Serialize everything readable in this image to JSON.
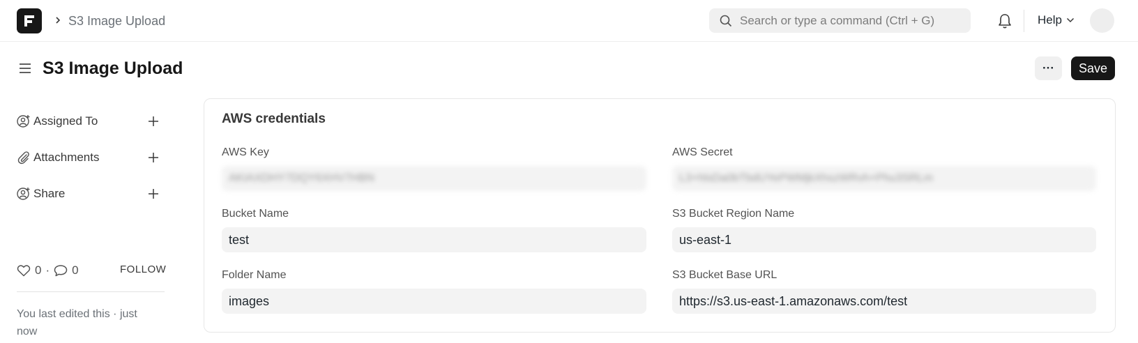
{
  "navbar": {
    "logo_letter": "F",
    "breadcrumb": "S3 Image Upload",
    "search_placeholder": "Search or type a command (Ctrl + G)",
    "help_label": "Help"
  },
  "page": {
    "title": "S3 Image Upload",
    "more_label": "···",
    "save_label": "Save"
  },
  "sidebar": {
    "items": [
      {
        "label": "Assigned To",
        "icon": "user-plus-icon"
      },
      {
        "label": "Attachments",
        "icon": "paperclip-icon"
      },
      {
        "label": "Share",
        "icon": "user-plus-icon"
      }
    ],
    "likes_count": "0",
    "comments_count": "0",
    "follow_label": "FOLLOW",
    "last_edited": "You last edited this · just now"
  },
  "form": {
    "section_title": "AWS credentials",
    "aws_key": {
      "label": "AWS Key",
      "value": "AKIAXDHY7DQY6XHV7HBN"
    },
    "aws_secret": {
      "label": "AWS Secret",
      "value": "L3+hlsDa0bTbdUYePWMjkXhszWRvh+Phu3SRLm"
    },
    "bucket_name": {
      "label": "Bucket Name",
      "value": "test"
    },
    "region_name": {
      "label": "S3 Bucket Region Name",
      "value": "us-east-1"
    },
    "folder_name": {
      "label": "Folder Name",
      "value": "images"
    },
    "base_url": {
      "label": "S3 Bucket Base URL",
      "value": "https://s3.us-east-1.amazonaws.com/test"
    }
  },
  "colors": {
    "primary": "#171717",
    "input_bg": "#f3f3f3",
    "border": "#e7e7e7"
  }
}
